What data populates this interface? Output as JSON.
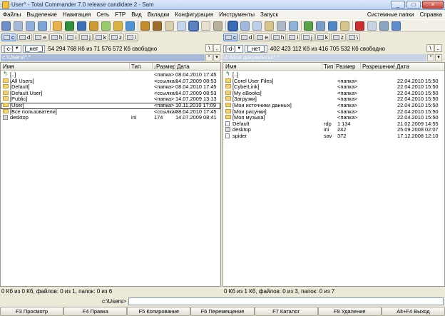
{
  "window": {
    "title": "User^ - Total Commander 7.0 release candidate 2 - Sam",
    "minimize": "_",
    "maximize": "□",
    "close": "×"
  },
  "menu": {
    "items": [
      "Файлы",
      "Выделение",
      "Навигация",
      "Сеть",
      "FTP",
      "Вид",
      "Вкладки",
      "Конфигурация",
      "Инструменты",
      "Запуск"
    ],
    "right_items": [
      "Системные папки",
      "Справка"
    ]
  },
  "toolbar": {
    "icons": [
      {
        "name": "refresh-icon",
        "color": "#6d8fc9"
      },
      {
        "name": "view-list-icon",
        "color": "#a7b9d8"
      },
      {
        "name": "view-brief-icon",
        "color": "#8fb0de"
      },
      {
        "name": "sort-icon",
        "color": "#7ba5d8"
      },
      {
        "name": "pack-icon",
        "color": "#e9b24a"
      },
      {
        "name": "unpack-icon",
        "color": "#2f8f3a"
      },
      {
        "name": "find-icon",
        "color": "#3c6fb8"
      },
      {
        "name": "sync-icon",
        "color": "#cc9a2e"
      },
      {
        "name": "rename-icon",
        "color": "#9acb6b"
      },
      {
        "name": "ftp-icon",
        "color": "#d9b33e"
      },
      {
        "name": "browser-icon",
        "color": "#4f93d7"
      },
      {
        "name": "back-icon",
        "color": "#c38a2a"
      },
      {
        "name": "forward-icon",
        "color": "#9c6e2a"
      },
      {
        "name": "dirs-icon",
        "color": "#d9d0b0"
      },
      {
        "name": "branch-icon",
        "color": "#c5d7ef"
      },
      {
        "name": "tree-icon",
        "color": "#5d84c1"
      },
      {
        "name": "search-icon",
        "color": "#e5e1cf"
      },
      {
        "name": "compare-icon",
        "color": "#b7b09a"
      },
      {
        "name": "panel-icon",
        "color": "#3a6cb5"
      },
      {
        "name": "copy-icon",
        "color": "#9fb9de"
      },
      {
        "name": "move-icon",
        "color": "#bdd0ea"
      },
      {
        "name": "mkdir-icon",
        "color": "#d8c38d"
      },
      {
        "name": "net-icon",
        "color": "#aeb9c8"
      },
      {
        "name": "plugin-icon",
        "color": "#8eb2da"
      },
      {
        "name": "settings-icon",
        "color": "#57a24a"
      },
      {
        "name": "user-icon",
        "color": "#7a9cc8"
      },
      {
        "name": "view-icon",
        "color": "#4f86c6"
      },
      {
        "name": "mail-icon",
        "color": "#d7c48a"
      },
      {
        "name": "delete-icon",
        "color": "#cc2d2d"
      },
      {
        "name": "notepad-icon",
        "color": "#c6d3e2"
      },
      {
        "name": "monitor-icon",
        "color": "#8aa3c1"
      },
      {
        "name": "globe-icon",
        "color": "#5d8ccf"
      }
    ]
  },
  "left": {
    "drives": [
      "c",
      "d",
      "e",
      "h",
      "i",
      "j",
      "k",
      "z",
      "\\"
    ],
    "drive_combo": "[-c-]",
    "label": "[_нет_]",
    "free": "54 294 768 Кб из 71 576 572 Кб свободно",
    "path": "c:\\Users\\*.*",
    "columns": [
      "Имя",
      "Тип",
      "↓Размер",
      "Дата"
    ],
    "files": [
      {
        "name": "[..]",
        "type": "",
        "size": "<папка>",
        "date": "08.04.2010 17:45",
        "icon": "up"
      },
      {
        "name": "[All Users]",
        "type": "",
        "size": "<ссылка>",
        "date": "14.07.2009 08:53",
        "icon": "folder"
      },
      {
        "name": "[Default]",
        "type": "",
        "size": "<папка>",
        "date": "08.04.2010 17:45",
        "icon": "folder"
      },
      {
        "name": "[Default User]",
        "type": "",
        "size": "<ссылка>",
        "date": "14.07.2009 08:53",
        "icon": "folder"
      },
      {
        "name": "[Public]",
        "type": "",
        "size": "<папка>",
        "date": "14.07.2009 13:13",
        "icon": "folder"
      },
      {
        "name": "[User]",
        "type": "",
        "size": "<папка>",
        "date": "10.11.2010 17:09",
        "icon": "folder"
      },
      {
        "name": "[Все пользователи]",
        "type": "",
        "size": "<ссылка>",
        "date": "08.04.2010 17:45",
        "icon": "folder"
      },
      {
        "name": "desktop",
        "type": "ini",
        "size": "174",
        "date": "14.07.2009 08:41",
        "icon": "sys"
      }
    ],
    "status": "0 Кб из 0 Кб, файлов: 0 из 1, папок: 0 из 6"
  },
  "right": {
    "drives": [
      "c",
      "d",
      "e",
      "h",
      "i",
      "j",
      "k",
      "z",
      "\\"
    ],
    "drive_combo": "[-d-]",
    "label": "[_нет_]",
    "free": "402 423 112 Кб из 416 705 532 Кб свободно",
    "path": "d:\\Мои документы\\*.*",
    "columns": [
      "Имя",
      "Тип",
      "Размер",
      "Разрешение",
      "Дата"
    ],
    "files": [
      {
        "name": "[..]",
        "type": "",
        "size": "",
        "date": "",
        "icon": "up"
      },
      {
        "name": "[Corel User Files]",
        "type": "",
        "size": "<папка>",
        "date": "22.04.2010 15:50",
        "icon": "folder"
      },
      {
        "name": "[CyberLink]",
        "type": "",
        "size": "<папка>",
        "date": "22.04.2010 15:50",
        "icon": "folder"
      },
      {
        "name": "[My eBooks]",
        "type": "",
        "size": "<папка>",
        "date": "22.04.2010 15:50",
        "icon": "folder"
      },
      {
        "name": "[Загрузки]",
        "type": "",
        "size": "<папка>",
        "date": "22.04.2010 15:50",
        "icon": "folder"
      },
      {
        "name": "[Мои источники данных]",
        "type": "",
        "size": "<папка>",
        "date": "22.04.2010 15:50",
        "icon": "folder"
      },
      {
        "name": "[Мои рисунки]",
        "type": "",
        "size": "<папка>",
        "date": "22.04.2010 15:50",
        "icon": "folder"
      },
      {
        "name": "[Моя музыка]",
        "type": "",
        "size": "<папка>",
        "date": "22.04.2010 15:50",
        "icon": "folder"
      },
      {
        "name": "Default",
        "type": "rdp",
        "size": "1 134",
        "date": "21.02.2009 14:55",
        "icon": "file"
      },
      {
        "name": "desktop",
        "type": "ini",
        "size": "242",
        "date": "25.09.2008 02:07",
        "icon": "sys"
      },
      {
        "name": "spider",
        "type": "sav",
        "size": "372",
        "date": "17.12.2008 12:10",
        "icon": "file"
      }
    ],
    "status": "0 Кб из 1 Кб, файлов: 0 из 3, папок: 0 из 7"
  },
  "cmdline": {
    "label": "c:\\Users>"
  },
  "fkeys": [
    "F3 Просмотр",
    "F4 Правка",
    "F5 Копирование",
    "F6 Перемещение",
    "F7 Каталог",
    "F8 Удаление",
    "Alt+F4 Выход"
  ],
  "panel_buttons": {
    "back": "\\",
    "up": "..",
    "star": "*",
    "down": "▾"
  }
}
